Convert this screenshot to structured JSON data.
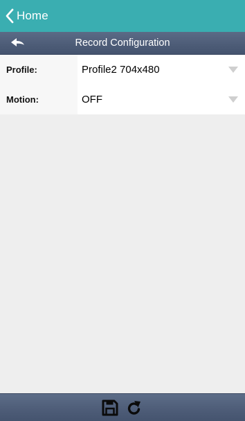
{
  "nav": {
    "home_label": "Home"
  },
  "header": {
    "title": "Record Configuration"
  },
  "form": {
    "rows": [
      {
        "label": "Profile:",
        "value": "Profile2 704x480"
      },
      {
        "label": "Motion:",
        "value": "OFF"
      }
    ]
  },
  "toolbar": {
    "buttons": [
      {
        "icon": "floppy-disk-icon",
        "action": "save"
      },
      {
        "icon": "refresh-icon",
        "action": "reload"
      }
    ]
  },
  "colors": {
    "nav_bar": "#3aaeb1",
    "title_bar": "#4e5d78",
    "content_background": "#eeeeee",
    "label_background": "#f7f7f7",
    "dropdown_arrow": "#cfcfcf"
  }
}
